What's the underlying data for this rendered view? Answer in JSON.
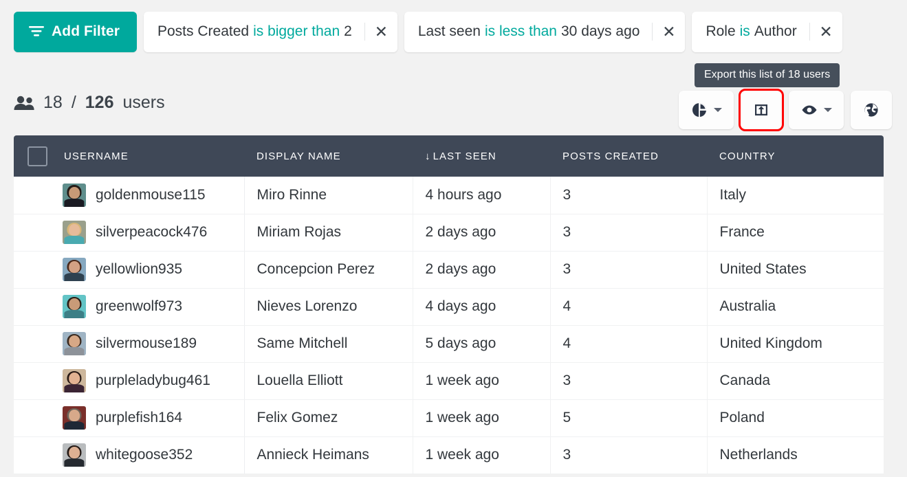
{
  "theme": {
    "accent": "#00a99d",
    "header_bg": "#3f4857",
    "page_bg": "#f2f2f2",
    "tooltip_bg": "#464f5b",
    "highlight_outline": "#ff0000",
    "text": "#32373c"
  },
  "filter_bar": {
    "add_filter_label": "Add Filter",
    "add_filter_icon": "filter-icon",
    "chips": [
      {
        "field": "Posts Created",
        "operator": "is bigger than",
        "value": "2",
        "close_icon": "close-icon"
      },
      {
        "field": "Last seen",
        "operator": "is less than",
        "value": "30 days ago",
        "close_icon": "close-icon"
      },
      {
        "field": "Role",
        "operator": "is",
        "value": "Author",
        "close_icon": "close-icon"
      }
    ]
  },
  "tooltip": {
    "text": "Export this list of 18 users"
  },
  "count": {
    "icon": "people-icon",
    "shown": "18",
    "separator": "/",
    "total": "126",
    "unit": "users"
  },
  "toolbar": {
    "buttons": [
      {
        "name": "chart-button",
        "icon": "pie-chart-icon",
        "has_caret": true
      },
      {
        "name": "export-button",
        "icon": "export-icon",
        "has_caret": false,
        "highlighted": true
      },
      {
        "name": "visibility-button",
        "icon": "eye-icon",
        "has_caret": true
      },
      {
        "name": "globe-button",
        "icon": "globe-icon",
        "has_caret": false
      }
    ]
  },
  "table": {
    "select_all_checkbox": "",
    "columns": [
      {
        "key": "username",
        "label": "USERNAME",
        "sorted": false
      },
      {
        "key": "display_name",
        "label": "DISPLAY NAME",
        "sorted": false
      },
      {
        "key": "last_seen",
        "label": "LAST SEEN",
        "sorted": true,
        "sort_arrow": "↓"
      },
      {
        "key": "posts_created",
        "label": "POSTS CREATED",
        "sorted": false
      },
      {
        "key": "country",
        "label": "COUNTRY",
        "sorted": false
      }
    ],
    "rows": [
      {
        "avatar": "avatar-photo",
        "username": "goldenmouse115",
        "display_name": "Miro Rinne",
        "last_seen": "4 hours ago",
        "posts_created": "3",
        "country": "Italy",
        "avatar_colors": {
          "bg": "#5f8e8c",
          "hair": "#241c18",
          "skin": "#c79a77",
          "body": "#1a1a22"
        }
      },
      {
        "avatar": "avatar-photo",
        "username": "silverpeacock476",
        "display_name": "Miriam Rojas",
        "last_seen": "2 days ago",
        "posts_created": "3",
        "country": "France",
        "avatar_colors": {
          "bg": "#9aa08c",
          "hair": "#d7b677",
          "skin": "#e6bb9a",
          "body": "#49aab0"
        }
      },
      {
        "avatar": "avatar-photo",
        "username": "yellowlion935",
        "display_name": "Concepcion Perez",
        "last_seen": "2 days ago",
        "posts_created": "3",
        "country": "United States",
        "avatar_colors": {
          "bg": "#86a8c0",
          "hair": "#4a2a1c",
          "skin": "#d3a184",
          "body": "#2f4150"
        }
      },
      {
        "avatar": "avatar-photo",
        "username": "greenwolf973",
        "display_name": "Nieves Lorenzo",
        "last_seen": "4 days ago",
        "posts_created": "4",
        "country": "Australia",
        "avatar_colors": {
          "bg": "#63c4c6",
          "hair": "#2b2019",
          "skin": "#c99b78",
          "body": "#3c7f86"
        }
      },
      {
        "avatar": "avatar-photo",
        "username": "silvermouse189",
        "display_name": "Same Mitchell",
        "last_seen": "5 days ago",
        "posts_created": "4",
        "country": "United Kingdom",
        "avatar_colors": {
          "bg": "#9fb4c4",
          "hair": "#3a2a20",
          "skin": "#d7a886",
          "body": "#8d9299"
        }
      },
      {
        "avatar": "avatar-photo",
        "username": "purpleladybug461",
        "display_name": "Louella Elliott",
        "last_seen": "1 week ago",
        "posts_created": "3",
        "country": "Canada",
        "avatar_colors": {
          "bg": "#cdb79c",
          "hair": "#2a1b16",
          "skin": "#e2b292",
          "body": "#3b2433"
        }
      },
      {
        "avatar": "avatar-photo",
        "username": "purplefish164",
        "display_name": "Felix Gomez",
        "last_seen": "1 week ago",
        "posts_created": "5",
        "country": "Poland",
        "avatar_colors": {
          "bg": "#7a2f2a",
          "hair": "#6d6459",
          "skin": "#d7a98a",
          "body": "#1e2836"
        }
      },
      {
        "avatar": "avatar-photo",
        "username": "whitegoose352",
        "display_name": "Annieck Heimans",
        "last_seen": "1 week ago",
        "posts_created": "3",
        "country": "Netherlands",
        "avatar_colors": {
          "bg": "#b9bcbe",
          "hair": "#241a16",
          "skin": "#ddb093",
          "body": "#262a30"
        }
      }
    ]
  }
}
